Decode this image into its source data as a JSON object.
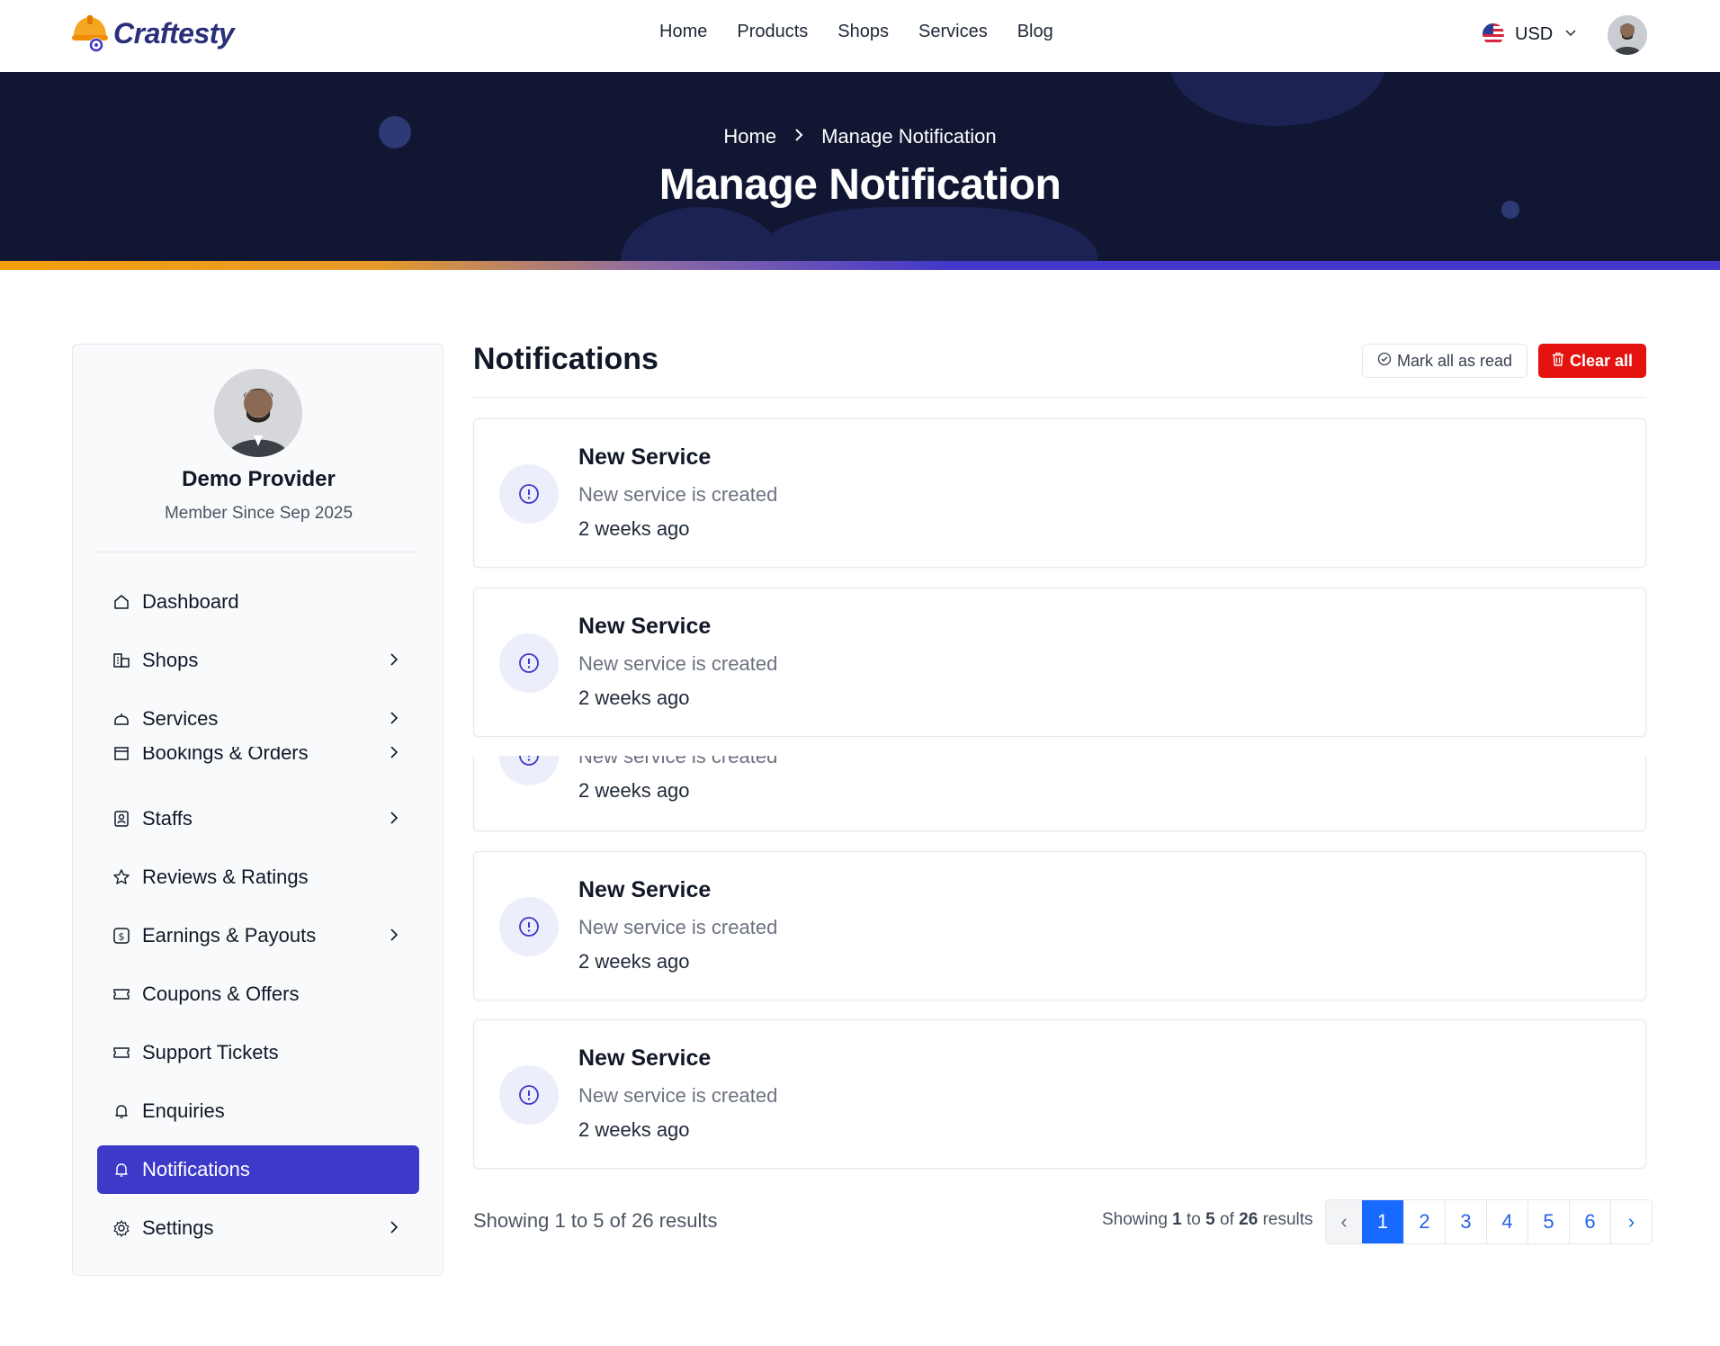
{
  "brand": {
    "name": "Craftesty"
  },
  "nav": [
    "Home",
    "Products",
    "Shops",
    "Services",
    "Blog"
  ],
  "currency": "USD",
  "hero": {
    "breadcrumb_home": "Home",
    "breadcrumb_current": "Manage Notification",
    "title": "Manage Notification"
  },
  "profile": {
    "name": "Demo Provider",
    "member_since": "Member Since Sep 2025"
  },
  "sidebar": {
    "items": [
      {
        "label": "Dashboard",
        "icon": "home-icon",
        "chevron": false
      },
      {
        "label": "Shops",
        "icon": "shop-icon",
        "chevron": true
      },
      {
        "label": "Services",
        "icon": "services-icon",
        "chevron": true
      },
      {
        "label": "Bookings & Orders",
        "icon": "calendar-icon",
        "chevron": true
      },
      {
        "label": "Staffs",
        "icon": "staff-icon",
        "chevron": true
      },
      {
        "label": "Reviews & Ratings",
        "icon": "star-icon",
        "chevron": false
      },
      {
        "label": "Earnings & Payouts",
        "icon": "dollar-icon",
        "chevron": true
      },
      {
        "label": "Coupons & Offers",
        "icon": "ticket-icon",
        "chevron": false
      },
      {
        "label": "Support Tickets",
        "icon": "ticket-icon",
        "chevron": false
      },
      {
        "label": "Enquiries",
        "icon": "bell-icon",
        "chevron": false
      },
      {
        "label": "Notifications",
        "icon": "bell-icon",
        "chevron": false,
        "active": true
      },
      {
        "label": "Settings",
        "icon": "gear-icon",
        "chevron": true
      }
    ]
  },
  "main": {
    "title": "Notifications",
    "mark_all_label": "Mark all as read",
    "clear_all_label": "Clear all"
  },
  "notifications": [
    {
      "title": "New Service",
      "desc": "New service is created",
      "time": "2 weeks ago"
    },
    {
      "title": "New Service",
      "desc": "New service is created",
      "time": "2 weeks ago"
    },
    {
      "title": "",
      "desc": "New service is created",
      "time": "2 weeks ago"
    },
    {
      "title": "New Service",
      "desc": "New service is created",
      "time": "2 weeks ago"
    },
    {
      "title": "New Service",
      "desc": "New service is created",
      "time": "2 weeks ago"
    }
  ],
  "pagination": {
    "summary_left": "Showing 1 to 5 of 26 results",
    "summary_prefix": "Showing",
    "summary_from": "1",
    "summary_to_word": "to",
    "summary_to": "5",
    "summary_of_word": "of",
    "summary_total": "26",
    "summary_suffix": "results",
    "prev": "‹",
    "pages": [
      "1",
      "2",
      "3",
      "4",
      "5",
      "6"
    ],
    "next": "›",
    "current": "1"
  }
}
